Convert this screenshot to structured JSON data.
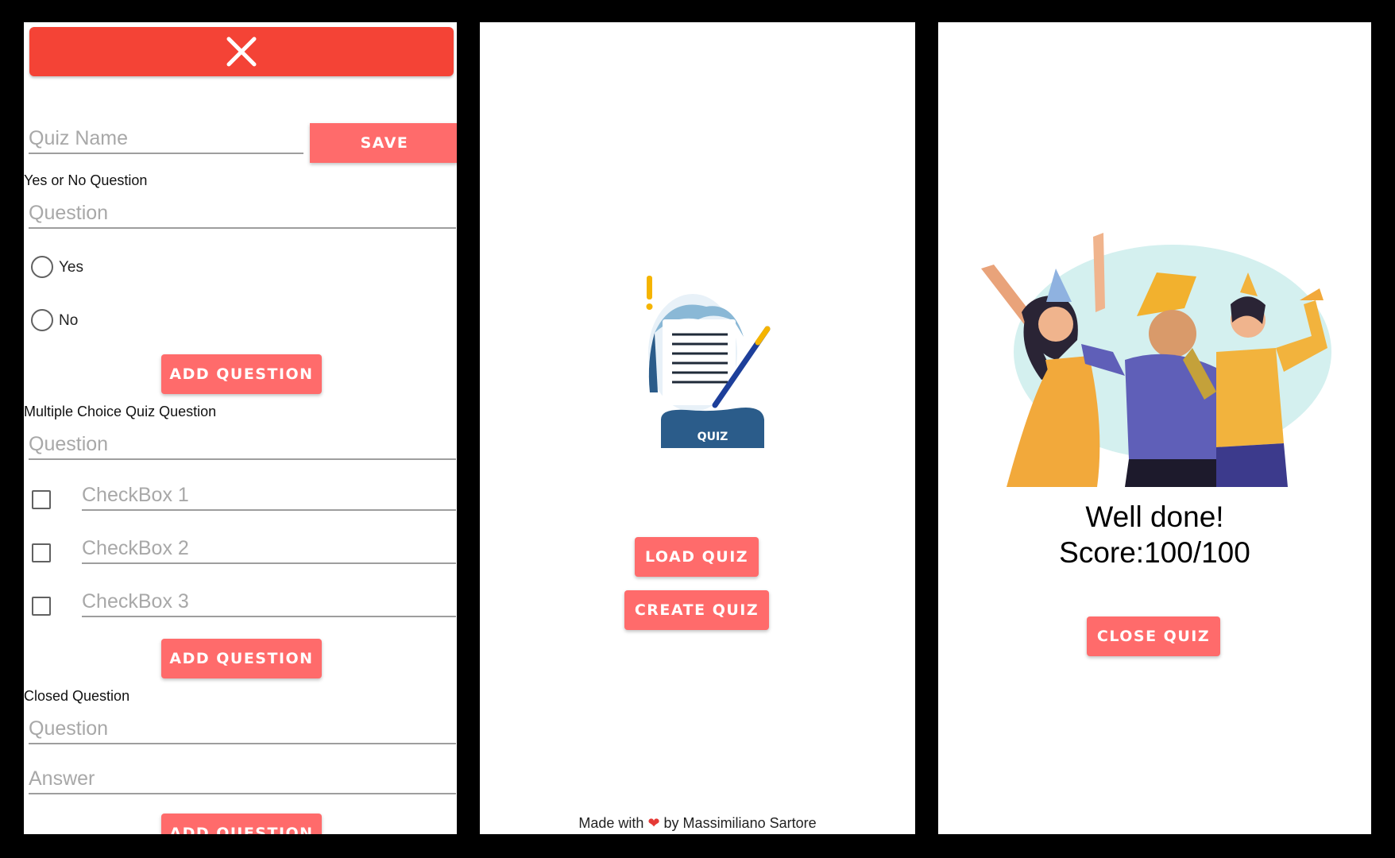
{
  "create_screen": {
    "close_icon": "close-icon",
    "quiz_name_placeholder": "Quiz Name",
    "save_label": "SAVE",
    "yes_no": {
      "title": "Yes or No Question",
      "question_placeholder": "Question",
      "options": [
        "Yes",
        "No"
      ],
      "add_label": "ADD QUESTION"
    },
    "multiple_choice": {
      "title": "Multiple Choice Quiz Question",
      "question_placeholder": "Question",
      "checkbox_placeholders": [
        "CheckBox 1",
        "CheckBox 2",
        "CheckBox 3"
      ],
      "add_label": "ADD QUESTION"
    },
    "closed": {
      "title": "Closed Question",
      "question_placeholder": "Question",
      "answer_placeholder": "Answer",
      "add_label": "ADD QUESTION"
    }
  },
  "home_screen": {
    "logo_text": "QUIZ",
    "load_label": "LOAD QUIZ",
    "create_label": "CREATE QUIZ",
    "footer_prefix": "Made with",
    "footer_suffix": "by Massimiliano Sartore"
  },
  "result_screen": {
    "title": "Well done!",
    "score": "Score:100/100",
    "close_label": "CLOSE QUIZ"
  },
  "colors": {
    "accent": "#ff6b6b",
    "close_bar": "#f44336",
    "background": "#000000"
  }
}
